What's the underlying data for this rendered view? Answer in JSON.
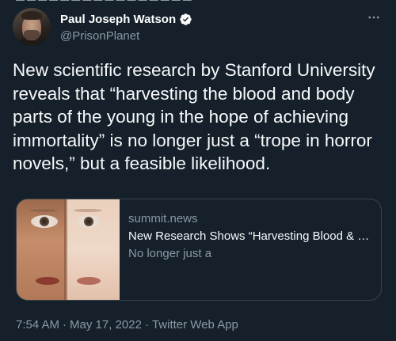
{
  "author": {
    "display_name": "Paul Joseph Watson",
    "handle": "@PrisonPlanet"
  },
  "tweet": {
    "text": "New scientific research by Stanford University reveals that “harvesting the blood and body parts of the young in the hope of achieving immortality” is no longer just a “trope in horror novels,” but a feasible likelihood."
  },
  "link_card": {
    "domain": "summit.news",
    "title": "New Research Shows “Harvesting Blood & Body Parts of the Young”",
    "description": "No longer just a"
  },
  "meta": {
    "time": "7:54 AM",
    "date": "May 17, 2022",
    "separator": "·",
    "source": "Twitter Web App"
  },
  "icons": {
    "verified": "verified-badge-icon",
    "more": "more-options-icon"
  },
  "colors": {
    "background": "#15202b",
    "text_primary": "#f7f9f9",
    "text_secondary": "#8b98a5",
    "border": "#38444d"
  }
}
